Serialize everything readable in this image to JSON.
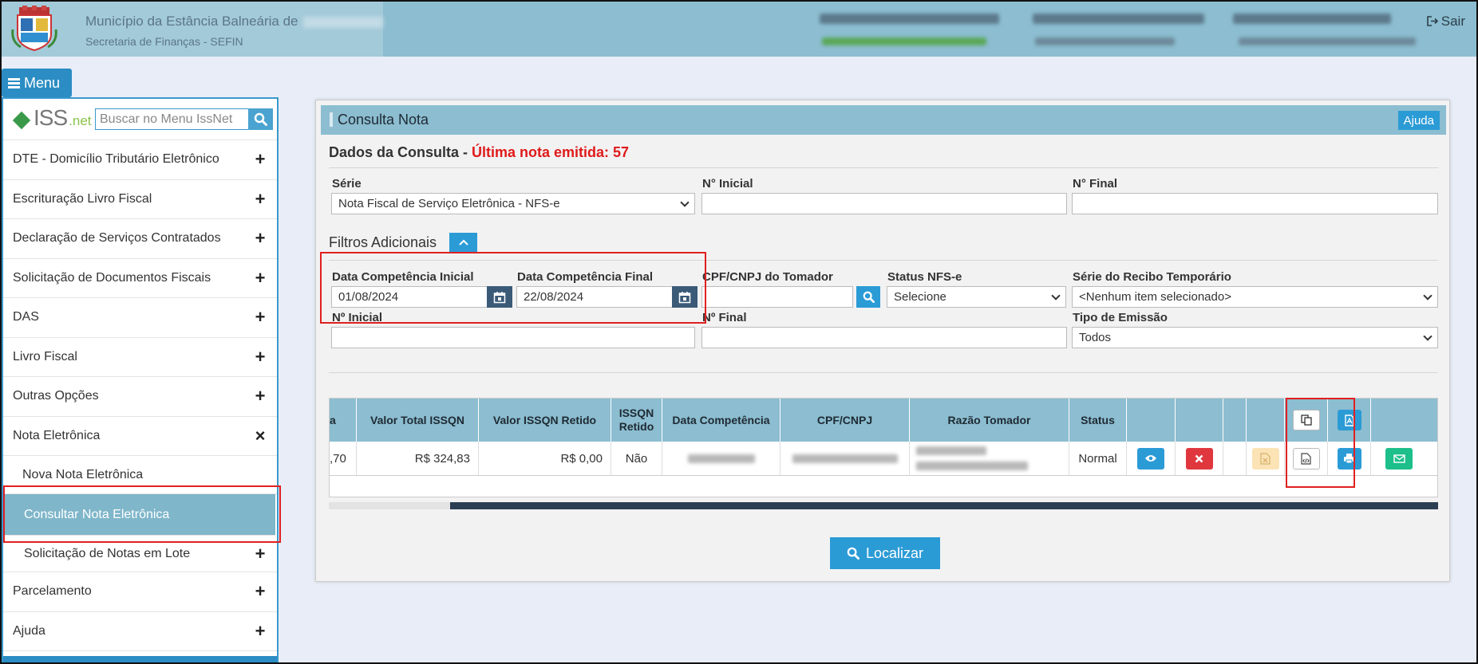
{
  "header": {
    "title": "Município da Estância Balneária de",
    "subtitle": "Secretaria de Finanças - SEFIN",
    "logout_label": "Sair"
  },
  "menu_button": {
    "label": "Menu"
  },
  "sidebar": {
    "logo_iss": "ISS",
    "logo_net": ".net",
    "search_placeholder": "Buscar no Menu IssNet",
    "items": [
      {
        "label": "DTE - Domicílio Tributário Eletrônico",
        "toggle": "+"
      },
      {
        "label": "Escrituração Livro Fiscal",
        "toggle": "+"
      },
      {
        "label": "Declaração de Serviços Contratados",
        "toggle": "+"
      },
      {
        "label": "Solicitação de Documentos Fiscais",
        "toggle": "+"
      },
      {
        "label": "DAS",
        "toggle": "+"
      },
      {
        "label": "Livro Fiscal",
        "toggle": "+"
      },
      {
        "label": "Outras Opções",
        "toggle": "+"
      },
      {
        "label": "Nota Eletrônica",
        "toggle": "×"
      },
      {
        "label": "Nova Nota Eletrônica",
        "toggle": ""
      },
      {
        "label": "Consultar Nota Eletrônica",
        "toggle": ""
      },
      {
        "label": "Solicitação de Notas em Lote",
        "toggle": "+"
      },
      {
        "label": "Parcelamento",
        "toggle": "+"
      },
      {
        "label": "Ajuda",
        "toggle": "+"
      }
    ]
  },
  "panel": {
    "title": "Consulta Nota",
    "help_label": "Ajuda",
    "dados_title": "Dados da Consulta - ",
    "ultima_nota": "Última nota emitida: 57",
    "serie_label": "Série",
    "serie_value": "Nota Fiscal de Serviço Eletrônica - NFS-e",
    "n_inicial_label": "N° Inicial",
    "n_final_label": "N° Final",
    "filtros_title": "Filtros Adicionais",
    "data_ini_label": "Data Competência Inicial",
    "data_ini_value": "01/08/2024",
    "data_fim_label": "Data Competência Final",
    "data_fim_value": "22/08/2024",
    "cpf_label": "CPF/CNPJ do Tomador",
    "status_label": "Status NFS-e",
    "status_value": "Selecione",
    "serie_recibo_label": "Série do Recibo Temporário",
    "serie_recibo_value": "<Nenhum item selecionado>",
    "n_inicial2_label": "Nº Inicial",
    "n_final2_label": "Nº Final",
    "tipo_emissao_label": "Tipo de Emissão",
    "tipo_emissao_value": "Todos",
    "localizar_label": "Localizar"
  },
  "table": {
    "headers": {
      "partial": "a",
      "valor_total_issqn": "Valor  Total ISSQN",
      "valor_issqn_retido": "Valor  ISSQN Retido",
      "issqn_retido": "ISSQN Retido",
      "data_competencia": "Data Competência",
      "cpf_cnpj": "CPF/CNPJ",
      "razao_tomador": "Razão Tomador",
      "status": "Status"
    },
    "row": {
      "partial": ",70",
      "valor_total_issqn": "R$ 324,83",
      "valor_issqn_retido": "R$ 0,00",
      "issqn_retido": "Não",
      "status": "Normal"
    }
  },
  "colors": {
    "header_bg": "#8cbdd0",
    "accent_blue": "#2b9bd6",
    "danger_red": "#e0373f",
    "success_green": "#1dbf8a",
    "warning_light": "#fbe3b6",
    "highlight_red": "#e02020"
  },
  "icons": [
    "crest-logo",
    "calendar-icon",
    "search-icon",
    "chevron-up-icon",
    "eye-icon",
    "x-icon",
    "excel-icon",
    "copy-icon",
    "xml-file-icon",
    "pdf-icon",
    "print-icon",
    "envelope-icon",
    "logout-icon"
  ]
}
